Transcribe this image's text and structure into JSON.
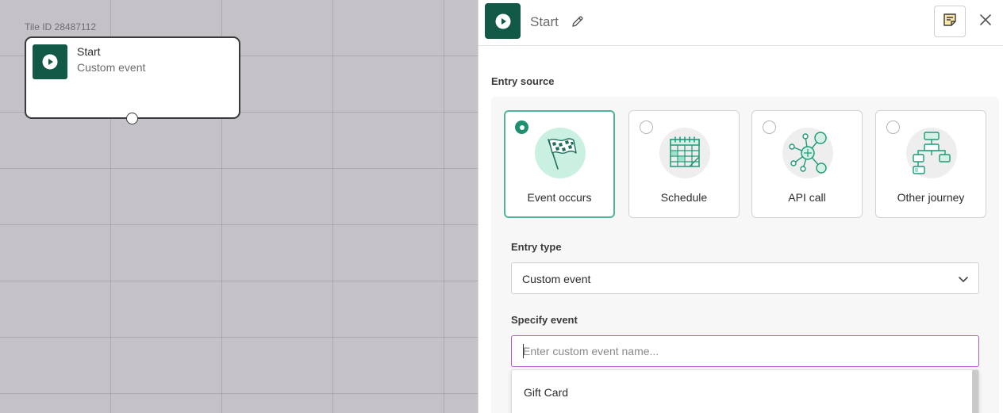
{
  "canvas": {
    "tile_id_label": "Tile ID 28487112",
    "tile": {
      "title": "Start",
      "subtitle": "Custom event",
      "icon": "play-icon"
    }
  },
  "panel": {
    "header": {
      "title": "Start",
      "icon": "play-icon",
      "edit_icon": "pencil-icon",
      "notes_icon": "notes-icon",
      "close_icon": "close-icon"
    },
    "entry_source": {
      "label": "Entry source",
      "options": [
        {
          "label": "Event occurs",
          "icon": "checkered-flag-icon",
          "selected": true
        },
        {
          "label": "Schedule",
          "icon": "calendar-icon",
          "selected": false
        },
        {
          "label": "API call",
          "icon": "api-network-icon",
          "selected": false
        },
        {
          "label": "Other journey",
          "icon": "flowchart-icon",
          "selected": false
        }
      ]
    },
    "entry_type": {
      "label": "Entry type",
      "value": "Custom event"
    },
    "specify_event": {
      "label": "Specify event",
      "placeholder": "Enter custom event name...",
      "value": "",
      "suggestions": [
        "Gift Card"
      ]
    }
  },
  "colors": {
    "brand_green": "#115847",
    "selected_accent": "#1e8f6f",
    "selected_border": "#4fb49a",
    "focus_border": "#b458c8"
  }
}
